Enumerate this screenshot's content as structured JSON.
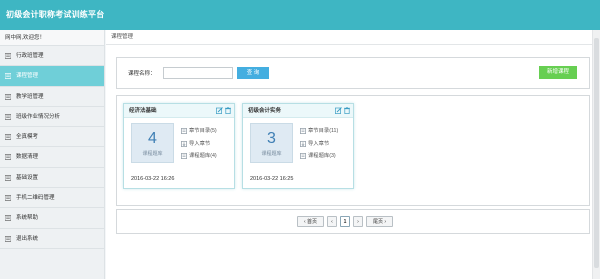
{
  "header": {
    "title": "初级会计职称考试训练平台",
    "bg_color": "#3eb6c3"
  },
  "sidebar": {
    "welcome": "网中网,欢迎您！",
    "items": [
      {
        "label": "行政班管理",
        "icon": "list-icon"
      },
      {
        "label": "课程管理",
        "icon": "list-icon",
        "active": true
      },
      {
        "label": "教学班管理",
        "icon": "list-icon"
      },
      {
        "label": "班级作业情况分析",
        "icon": "list-icon"
      },
      {
        "label": "全真模考",
        "icon": "list-icon"
      },
      {
        "label": "数据清理",
        "icon": "list-icon"
      },
      {
        "label": "基础设置",
        "icon": "list-icon"
      },
      {
        "label": "手机二维码管理",
        "icon": "list-icon"
      },
      {
        "label": "系统帮助",
        "icon": "list-icon"
      },
      {
        "label": "退出系统",
        "icon": "list-icon"
      }
    ]
  },
  "main": {
    "breadcrumb": "课程管理",
    "search": {
      "label": "课程名称：",
      "value": "",
      "placeholder": "",
      "button": "查 询"
    },
    "add_button": "新增课程",
    "courses": [
      {
        "name": "经济法基础",
        "count": "4",
        "count_label": "课程题库",
        "links": [
          "章节目录(5)",
          "导入章节",
          "课程题库(4)"
        ],
        "date": "2016-03-22 16:26"
      },
      {
        "name": "初级会计实务",
        "count": "3",
        "count_label": "课程题库",
        "links": [
          "章节目录(11)",
          "导入章节",
          "课程题库(3)"
        ],
        "date": "2016-03-22 16:25"
      }
    ],
    "pagination": {
      "first": "首页",
      "prev": "‹",
      "page": "1",
      "next": "›",
      "last": "尾页"
    }
  },
  "colors": {
    "accent": "#3eb6c3",
    "active_nav": "#6fcfd8",
    "search_button": "#44aee0",
    "add_button": "#67cf52",
    "count_text": "#3f7fb4"
  }
}
